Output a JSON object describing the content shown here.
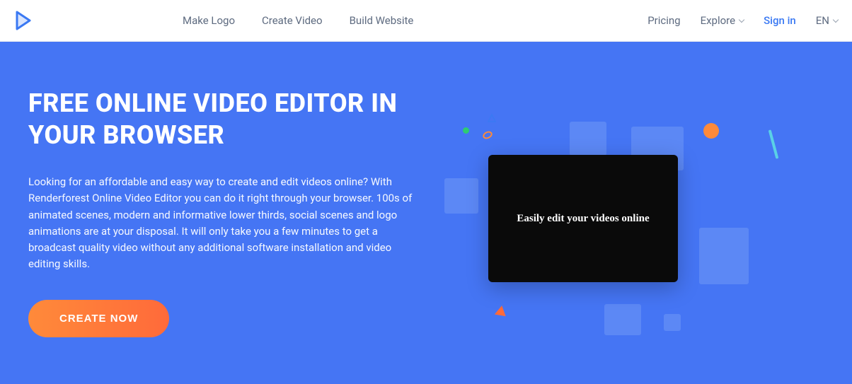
{
  "nav": {
    "make_logo": "Make Logo",
    "create_video": "Create Video",
    "build_website": "Build Website",
    "pricing": "Pricing",
    "explore": "Explore",
    "sign_in": "Sign in",
    "lang": "EN"
  },
  "hero": {
    "title": "FREE ONLINE VIDEO EDITOR IN YOUR BROWSER",
    "description": "Looking for an affordable and easy way to create and edit videos online? With Renderforest Online Video Editor you can do it right through your browser. 100s of animated scenes, modern and informative lower thirds, social scenes and logo animations are at your disposal. It will only take you a few minutes to get a broadcast quality video without any additional software installation and video editing skills.",
    "cta": "CREATE NOW",
    "preview_text": "Easily edit your videos online"
  }
}
